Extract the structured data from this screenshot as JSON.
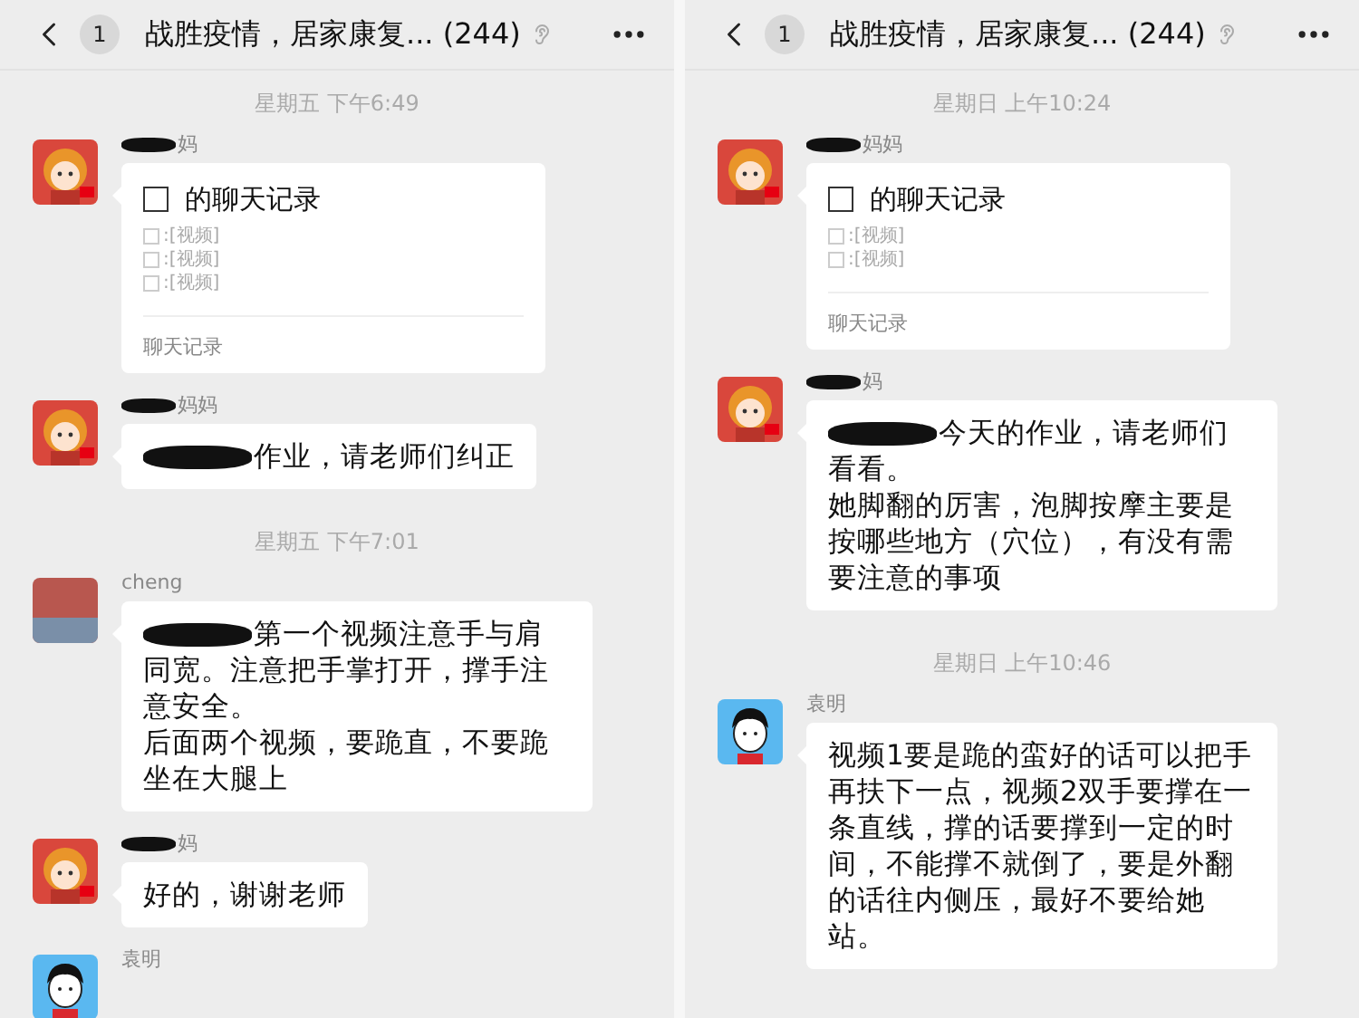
{
  "panels": [
    {
      "header": {
        "badge": "1",
        "title": "战胜疫情，居家康复... (244)"
      },
      "messages": [
        {
          "kind": "time",
          "text": "星期五 下午6:49"
        },
        {
          "kind": "record",
          "avatar": {
            "kind": "girl"
          },
          "sender": "妈",
          "sender_redacted": true,
          "title": "的聊天记录",
          "lines": [
            ":[视频]",
            ":[视频]",
            ":[视频]"
          ],
          "footer": "聊天记录"
        },
        {
          "kind": "text",
          "avatar": {
            "kind": "girl"
          },
          "sender": "妈妈",
          "sender_redacted": true,
          "paragraphs": [
            "作业，请老师们纠正"
          ],
          "text_redacted": true
        },
        {
          "kind": "time",
          "text": "星期五 下午7:01"
        },
        {
          "kind": "text",
          "avatar": {
            "kind": "photo"
          },
          "sender": "cheng",
          "paragraphs": [
            "第一个视频注意手与肩同宽。注意把手掌打开，撑手注意安全。",
            "后面两个视频，要跪直，不要跪坐在大腿上"
          ],
          "text_redacted": true
        },
        {
          "kind": "text",
          "avatar": {
            "kind": "girl"
          },
          "sender": "妈",
          "sender_redacted": true,
          "paragraphs": [
            "好的，谢谢老师"
          ]
        },
        {
          "kind": "text",
          "avatar": {
            "kind": "boy"
          },
          "sender": "袁明"
        }
      ]
    },
    {
      "header": {
        "badge": "1",
        "title": "战胜疫情，居家康复... (244)"
      },
      "messages": [
        {
          "kind": "time",
          "text": "星期日 上午10:24"
        },
        {
          "kind": "record",
          "avatar": {
            "kind": "girl"
          },
          "sender": "妈妈",
          "sender_redacted": true,
          "title": "的聊天记录",
          "lines": [
            ":[视频]",
            ":[视频]"
          ],
          "footer": "聊天记录"
        },
        {
          "kind": "text",
          "avatar": {
            "kind": "girl"
          },
          "sender": "妈",
          "sender_redacted": true,
          "paragraphs": [
            "今天的作业，请老师们看看。",
            "她脚翻的厉害，泡脚按摩主要是按哪些地方（穴位），有没有需要注意的事项"
          ],
          "text_redacted": true
        },
        {
          "kind": "time",
          "text": "星期日 上午10:46"
        },
        {
          "kind": "text",
          "avatar": {
            "kind": "boy"
          },
          "sender": "袁明",
          "paragraphs": [
            "视频1要是跪的蛮好的话可以把手再扶下一点，视频2双手要撑在一条直线，撑的话要撑到一定的时间，不能撑不就倒了，要是外翻的话往内侧压，最好不要给她站。"
          ]
        }
      ]
    }
  ]
}
